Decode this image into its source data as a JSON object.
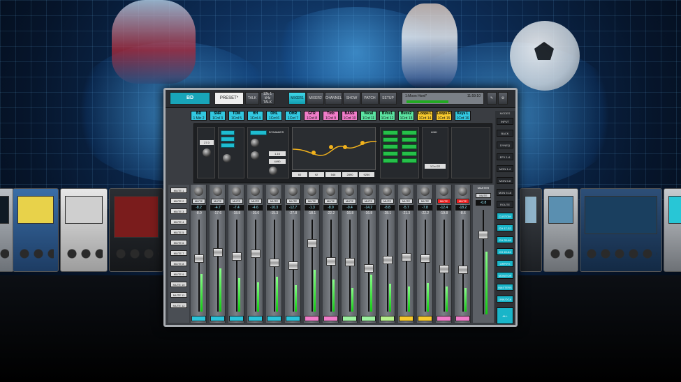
{
  "topbar": {
    "channel_name": "BD",
    "preset": "PRESET*",
    "talk": "TALK",
    "talk2": "12k\n1 kHz\nTALK",
    "tabs": [
      "MIXER1",
      "MIXER2",
      "CHANNEL",
      "SHOW",
      "PATCH",
      "SETUP"
    ],
    "active_tab": "MIXER1",
    "scene_name": "1:Moon Howl*",
    "scene_time": "11:59:10"
  },
  "channels": [
    {
      "name": "BD",
      "src": "1 Mic 2",
      "color": "#32c8e0",
      "db": "-8.2",
      "db2": "-8.0",
      "mute": false,
      "fader": 0.58,
      "meter": 0.45,
      "foot": "#2bc3d9"
    },
    {
      "name": "SNR",
      "src": "1Crd 3",
      "color": "#32c8e0",
      "db": "-4.7",
      "db2": "-17.6",
      "mute": false,
      "fader": 0.66,
      "meter": 0.52,
      "foot": "#2bc3d9"
    },
    {
      "name": "TOM",
      "src": "1Crd 5",
      "color": "#32c8e0",
      "db": "-7.4",
      "db2": "-18.8",
      "mute": false,
      "fader": 0.61,
      "meter": 0.4,
      "foot": "#2bc3d9"
    },
    {
      "name": "HH",
      "src": "1Crd 4",
      "color": "#32c8e0",
      "db": "-4.6",
      "db2": "-19.0",
      "mute": false,
      "fader": 0.64,
      "meter": 0.35,
      "foot": "#2bc3d9"
    },
    {
      "name": "OHL",
      "src": "1Crd 6",
      "color": "#32c8e0",
      "db": "-10.3",
      "db2": "-15.3",
      "mute": false,
      "fader": 0.53,
      "meter": 0.42,
      "foot": "#2bc3d9"
    },
    {
      "name": "OHR",
      "src": "1Crd 7",
      "color": "#32c8e0",
      "db": "-12.7",
      "db2": "-27.8",
      "mute": false,
      "fader": 0.5,
      "meter": 0.32,
      "foot": "#2bc3d9"
    },
    {
      "name": "GTR",
      "src": "1Crd 8",
      "color": "#f07cc8",
      "db": "-1.3",
      "db2": "-18.1",
      "mute": false,
      "fader": 0.77,
      "meter": 0.5,
      "foot": "#f07cc8"
    },
    {
      "name": "Tmb",
      "src": "1Crd 9",
      "color": "#f07cc8",
      "db": "-8.9",
      "db2": "-22.2",
      "mute": false,
      "fader": 0.55,
      "meter": 0.38,
      "foot": "#f07cc8"
    },
    {
      "name": "BASS",
      "src": "1Crd 10",
      "color": "#f07cc8",
      "db": "-9.4",
      "db2": "-16.8",
      "mute": false,
      "fader": 0.54,
      "meter": 0.28,
      "foot": "#9cf0a0"
    },
    {
      "name": "Vocal",
      "src": "1Crd 11",
      "color": "#5be3a1",
      "db": "-14.2",
      "db2": "-16.8",
      "mute": false,
      "fader": 0.47,
      "meter": 0.44,
      "foot": "#9cf0a0"
    },
    {
      "name": "BVox1",
      "src": "1Crd 12",
      "color": "#5be3a1",
      "db": "-8.8",
      "db2": "-28.1",
      "mute": false,
      "fader": 0.57,
      "meter": 0.33,
      "foot": "#b5f08c"
    },
    {
      "name": "Bvox2",
      "src": "1Crd 13",
      "color": "#5be3a1",
      "db": "-5.7",
      "db2": "-21.3",
      "mute": false,
      "fader": 0.6,
      "meter": 0.3,
      "foot": "#f7c92e"
    },
    {
      "name": "Loops L",
      "src": "1Crd 14",
      "color": "#f7c92e",
      "db": "-7.8",
      "db2": "-22.2",
      "mute": false,
      "fader": 0.58,
      "meter": 0.34,
      "foot": "#f7c92e"
    },
    {
      "name": "Loops R",
      "src": "1Crd 15",
      "color": "#f7c92e",
      "db": "-12.4",
      "db2": "-19.8",
      "mute": true,
      "fader": 0.46,
      "meter": 0.3,
      "foot": "#f07cc8"
    },
    {
      "name": "Keys L",
      "src": "1Crd 16",
      "color": "#32c8e0",
      "db": "-18.2",
      "db2": "-8.6",
      "mute": true,
      "fader": 0.45,
      "meter": 0.28,
      "foot": "#f07cc8"
    }
  ],
  "master": {
    "label": "MASTER",
    "db": "-0.8",
    "mute": "MUTE",
    "fader": 0.78,
    "meter": 0.6
  },
  "left_buttons": [
    "MUTE 1",
    "MUTE 2",
    "MUTE 3",
    "MUTE 4",
    "MUTE 5",
    "MUTE 6",
    "MUTE 7",
    "MUTE 8",
    "MUTE 9",
    "MUTE 10",
    "MUTE 11",
    "MUTE 12"
  ],
  "modes": {
    "title": "MODES",
    "title2": "LAYERS",
    "items": [
      "INPUT",
      "BACK",
      "DYNEQ",
      "EFX 1-6",
      "MON 1-4",
      "MON 5-8",
      "MON 9-16",
      "ROUTE",
      "CUSTOM",
      "CH 17-32",
      "CH 33-48",
      "CH 49-64",
      "GRP/FX",
      "MONITOR",
      "MASTERS",
      "LINK/DCA",
      "ALL"
    ],
    "active": [
      "CUSTOM",
      "CH 17-32",
      "CH 33-48",
      "CH 49-64",
      "GRP/FX",
      "MONITOR",
      "MASTERS",
      "LINK/DCA",
      "ALL"
    ]
  },
  "proc": {
    "gate_label": "GATE",
    "dyn_label": "DYNAMICS",
    "eq_label": "EQ",
    "eq_values": [
      "60",
      "92",
      "546",
      "2890",
      "9250"
    ],
    "eq_values2": [
      "3091",
      "1.6",
      "0.0",
      "2.4",
      "0.0"
    ],
    "knob_vals": [
      "27.0",
      "4.0",
      "1.16",
      "4490"
    ],
    "link": "LINK",
    "insert": "INSERT",
    "ch_label": "1Crd 22"
  },
  "colors": {
    "accent": "#19b5c9",
    "mute_on": "#e22222",
    "meter": "#22cc22"
  }
}
